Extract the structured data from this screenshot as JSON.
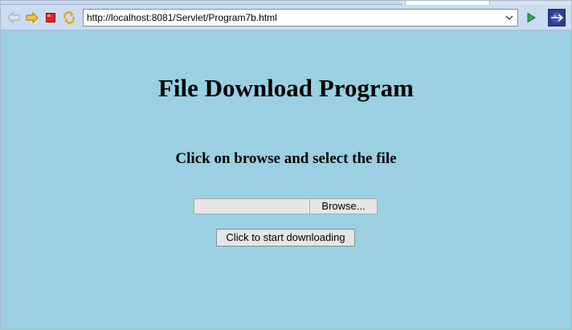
{
  "toolbar": {
    "icons": {
      "back": "back-arrow-icon",
      "forward": "forward-arrow-icon",
      "stop": "stop-icon",
      "refresh": "refresh-icon",
      "go": "go-play-icon",
      "eclipse": "eclipse-browser-icon"
    },
    "url": "http://localhost:8081/Servlet/Program7b.html"
  },
  "page": {
    "title": "File Download Program",
    "instruction": "Click on browse and select the file",
    "file_input": {
      "value": "",
      "browse_label": "Browse..."
    },
    "download_button_label": "Click to start downloading"
  },
  "colors": {
    "page_background": "#9ad0e2",
    "toolbar_background": "#ccdcf0",
    "button_face": "#e6e6e6"
  }
}
